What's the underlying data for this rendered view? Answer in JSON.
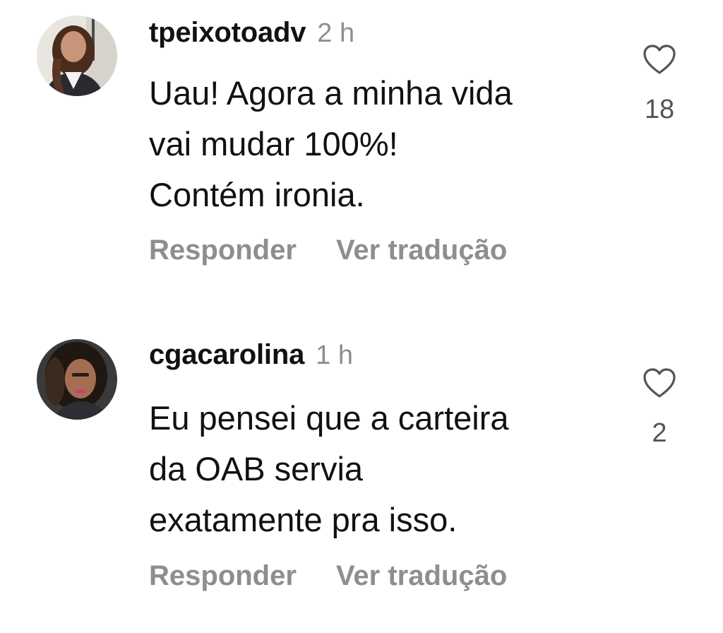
{
  "comments": [
    {
      "username": "tpeixotoadv",
      "time": "2 h",
      "text_lines": [
        "Uau! Agora a minha vida",
        "vai mudar 100%!",
        "Contém ironia."
      ],
      "likes": "18",
      "reply_label": "Responder",
      "translate_label": "Ver tradução"
    },
    {
      "username": "cgacarolina",
      "time": "1 h",
      "text_lines": [
        "Eu pensei que a carteira",
        "da OAB servia",
        "exatamente pra isso."
      ],
      "likes": "2",
      "reply_label": "Responder",
      "translate_label": "Ver tradução"
    }
  ],
  "icons": {
    "like": "heart-outline-icon"
  },
  "colors": {
    "text": "#111111",
    "secondary": "#8e8e8e",
    "count": "#555555",
    "background": "#ffffff"
  }
}
